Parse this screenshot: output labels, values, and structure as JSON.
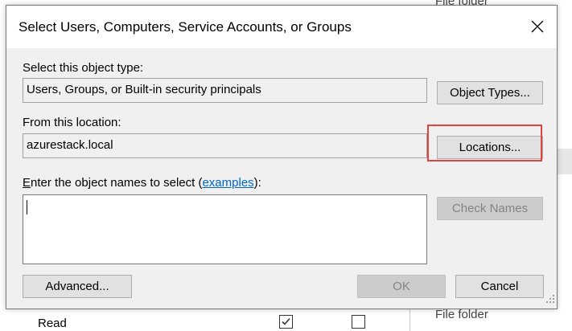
{
  "background": {
    "file_folder_top": "File folder",
    "file_folder_bottom": "File folder",
    "read_label": "Read"
  },
  "dialog": {
    "title": "Select Users, Computers, Service Accounts, or Groups",
    "object_type": {
      "label": "Select this object type:",
      "value": "Users, Groups, or Built-in security principals",
      "button": "Object Types..."
    },
    "location": {
      "label": "From this location:",
      "value": "azurestack.local",
      "button": "Locations..."
    },
    "names": {
      "label_access_key": "E",
      "label_before_link": "nter the object names to select (",
      "link": "examples",
      "label_after_link": "):",
      "value": "",
      "check_button": "Check Names"
    },
    "advanced_button": "Advanced...",
    "ok_button": "OK",
    "cancel_button": "Cancel"
  },
  "colors": {
    "highlight": "#e0443f",
    "link": "#0066cc",
    "dialog_bg": "#f0f0f0"
  }
}
